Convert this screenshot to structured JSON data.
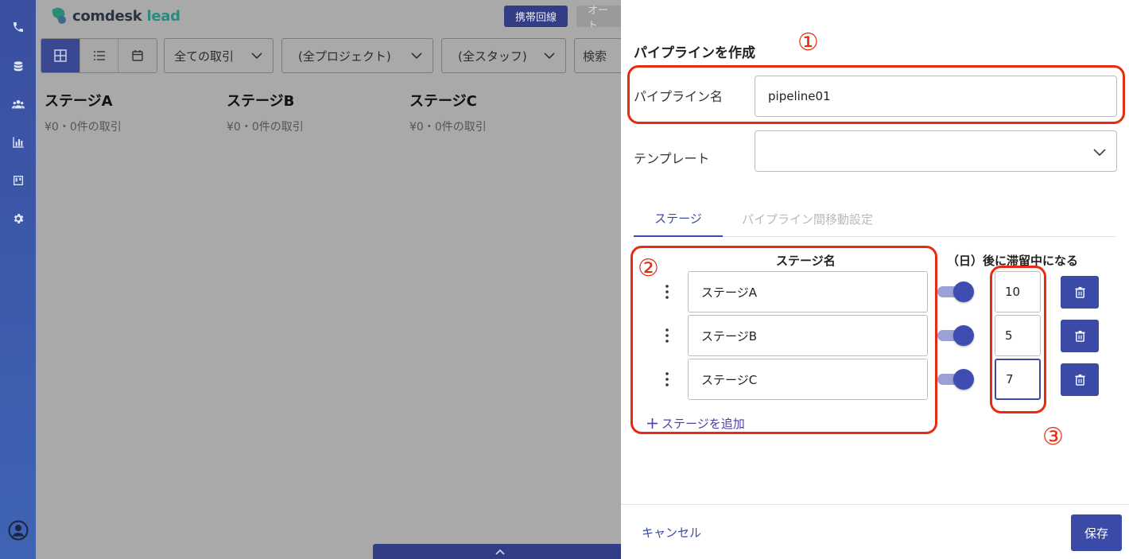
{
  "brand": {
    "name_part1": "comdesk",
    "name_part2": "lead",
    "accent": "#3a4aa6",
    "annotation_color": "#e82b10"
  },
  "rail": {
    "icons": [
      "phone-icon",
      "database-icon",
      "users-icon",
      "chart-icon",
      "board-icon",
      "gear-icon",
      "user-circle-icon"
    ]
  },
  "header": {
    "mobile_line_label": "携帯回線",
    "auto_label": "オート"
  },
  "toolbar": {
    "views": [
      "grid-view-icon",
      "list-view-icon",
      "calendar-view-icon"
    ],
    "filters": [
      {
        "label": "全ての取引"
      },
      {
        "label": "(全プロジェクト)"
      },
      {
        "label": "(全スタッフ)"
      }
    ],
    "search_placeholder": "検索"
  },
  "board": {
    "stages": [
      {
        "title": "ステージA",
        "summary": "¥0・0件の取引"
      },
      {
        "title": "ステージB",
        "summary": "¥0・0件の取引"
      },
      {
        "title": "ステージC",
        "summary": "¥0・0件の取引"
      }
    ]
  },
  "drawer": {
    "title": "パイプラインを作成",
    "pipeline_name_label": "パイプライン名",
    "pipeline_name_value": "pipeline01",
    "template_label": "テンプレート",
    "template_value": "",
    "tabs": [
      {
        "label": "ステージ",
        "active": true
      },
      {
        "label": "パイプライン間移動設定",
        "active": false
      }
    ],
    "stage_name_header": "ステージ名",
    "days_header": "（日）後に滞留中になる",
    "stages": [
      {
        "name": "ステージA",
        "enabled": true,
        "days": "10"
      },
      {
        "name": "ステージB",
        "enabled": true,
        "days": "5"
      },
      {
        "name": "ステージC",
        "enabled": true,
        "days": "7"
      }
    ],
    "add_stage_label": "ステージを追加",
    "cancel_label": "キャンセル",
    "save_label": "保存"
  },
  "annotations": [
    "①",
    "②",
    "③"
  ]
}
